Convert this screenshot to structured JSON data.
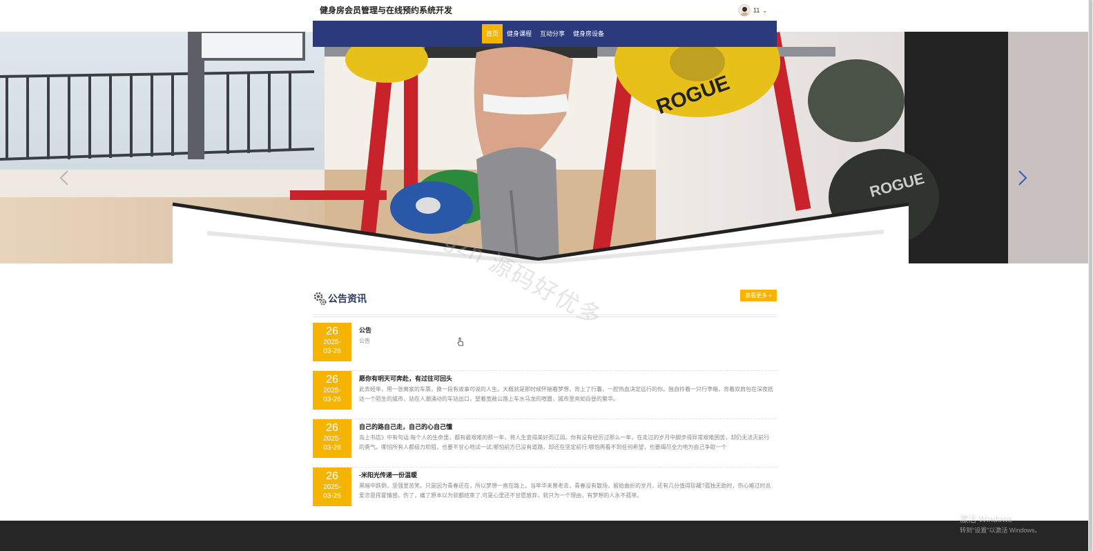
{
  "header": {
    "site_title": "健身房会员管理与在线预约系统开发",
    "user_name": "11",
    "chevron": "⌄"
  },
  "nav": {
    "items": [
      {
        "label": "首页",
        "active": true
      },
      {
        "label": "健身课程",
        "active": false
      },
      {
        "label": "互动分享",
        "active": false
      },
      {
        "label": "健身房设备",
        "active": false
      }
    ]
  },
  "banner": {
    "icon_prev": "chevron-left-icon",
    "icon_next": "chevron-right-icon"
  },
  "watermark": "gzh 源码好优多",
  "announcements": {
    "title": "公告资讯",
    "more_label": "查看更多 +",
    "items": [
      {
        "day": "26",
        "year_month": "2025-",
        "month_day": "03-26",
        "title": "公告",
        "summary": "公告"
      },
      {
        "day": "26",
        "year_month": "2025-",
        "month_day": "03-26",
        "title": "愿你有明天可奔赴，有过往可回头",
        "summary": "此去经年，用一张离家的车票，换一段有故事可说的人生。大概就是那时候怀揣着梦想，背上了行囊，一腔热血决定远行的你。独自拎着一只行李箱，背着双肩包在深夜抵达一个陌生的城市，站在人潮涌动的车站出口，望着宽敞公路上车水马龙的喧嚣，城市里亮如白昼的繁华。"
      },
      {
        "day": "26",
        "year_month": "2025-",
        "month_day": "03-26",
        "title": "自己的路自己走，自己的心自己懂",
        "summary": "岛上书店》中有句话:每个人的生命里，都有最艰难的那一年，将人生变得美好而辽阔。你有没有经历过那么一年，在走过的岁月中脚步得异常艰难困苦，却仍无法灭前行的勇气。哪怕所有人都极力劝阻，也要不甘心地试一试;哪怕前方已没有道路，却还在坚定前行;哪怕再看不到任何希望，也要竭尽全力地为自己争取一个"
      },
      {
        "day": "26",
        "year_month": "2025-",
        "month_day": "03-26",
        "title": "-米阳光传递一份温暖",
        "summary": "黑暗中跌倒，坚强里苦笑。只是因为青春还在，所以梦想一直在路上。当年华未曾老去，青春没有散场，留给曲折的岁月，还有几分值得珍藏?孤独无助时，伤心难过时总爱恣意挥霍情感。伤了，痛了原本以为就都结束了,可是心里还不甘愿放弃，就只为一个理由，有梦想的人永不孤单。"
      }
    ]
  },
  "os_overlay": {
    "activate_title": "激活 Windows",
    "activate_sub": "转到\"设置\"以激活 Windows。"
  },
  "colors": {
    "nav_bg": "#2b3a7c",
    "accent": "#f4b400",
    "footer_bg": "#262626"
  }
}
